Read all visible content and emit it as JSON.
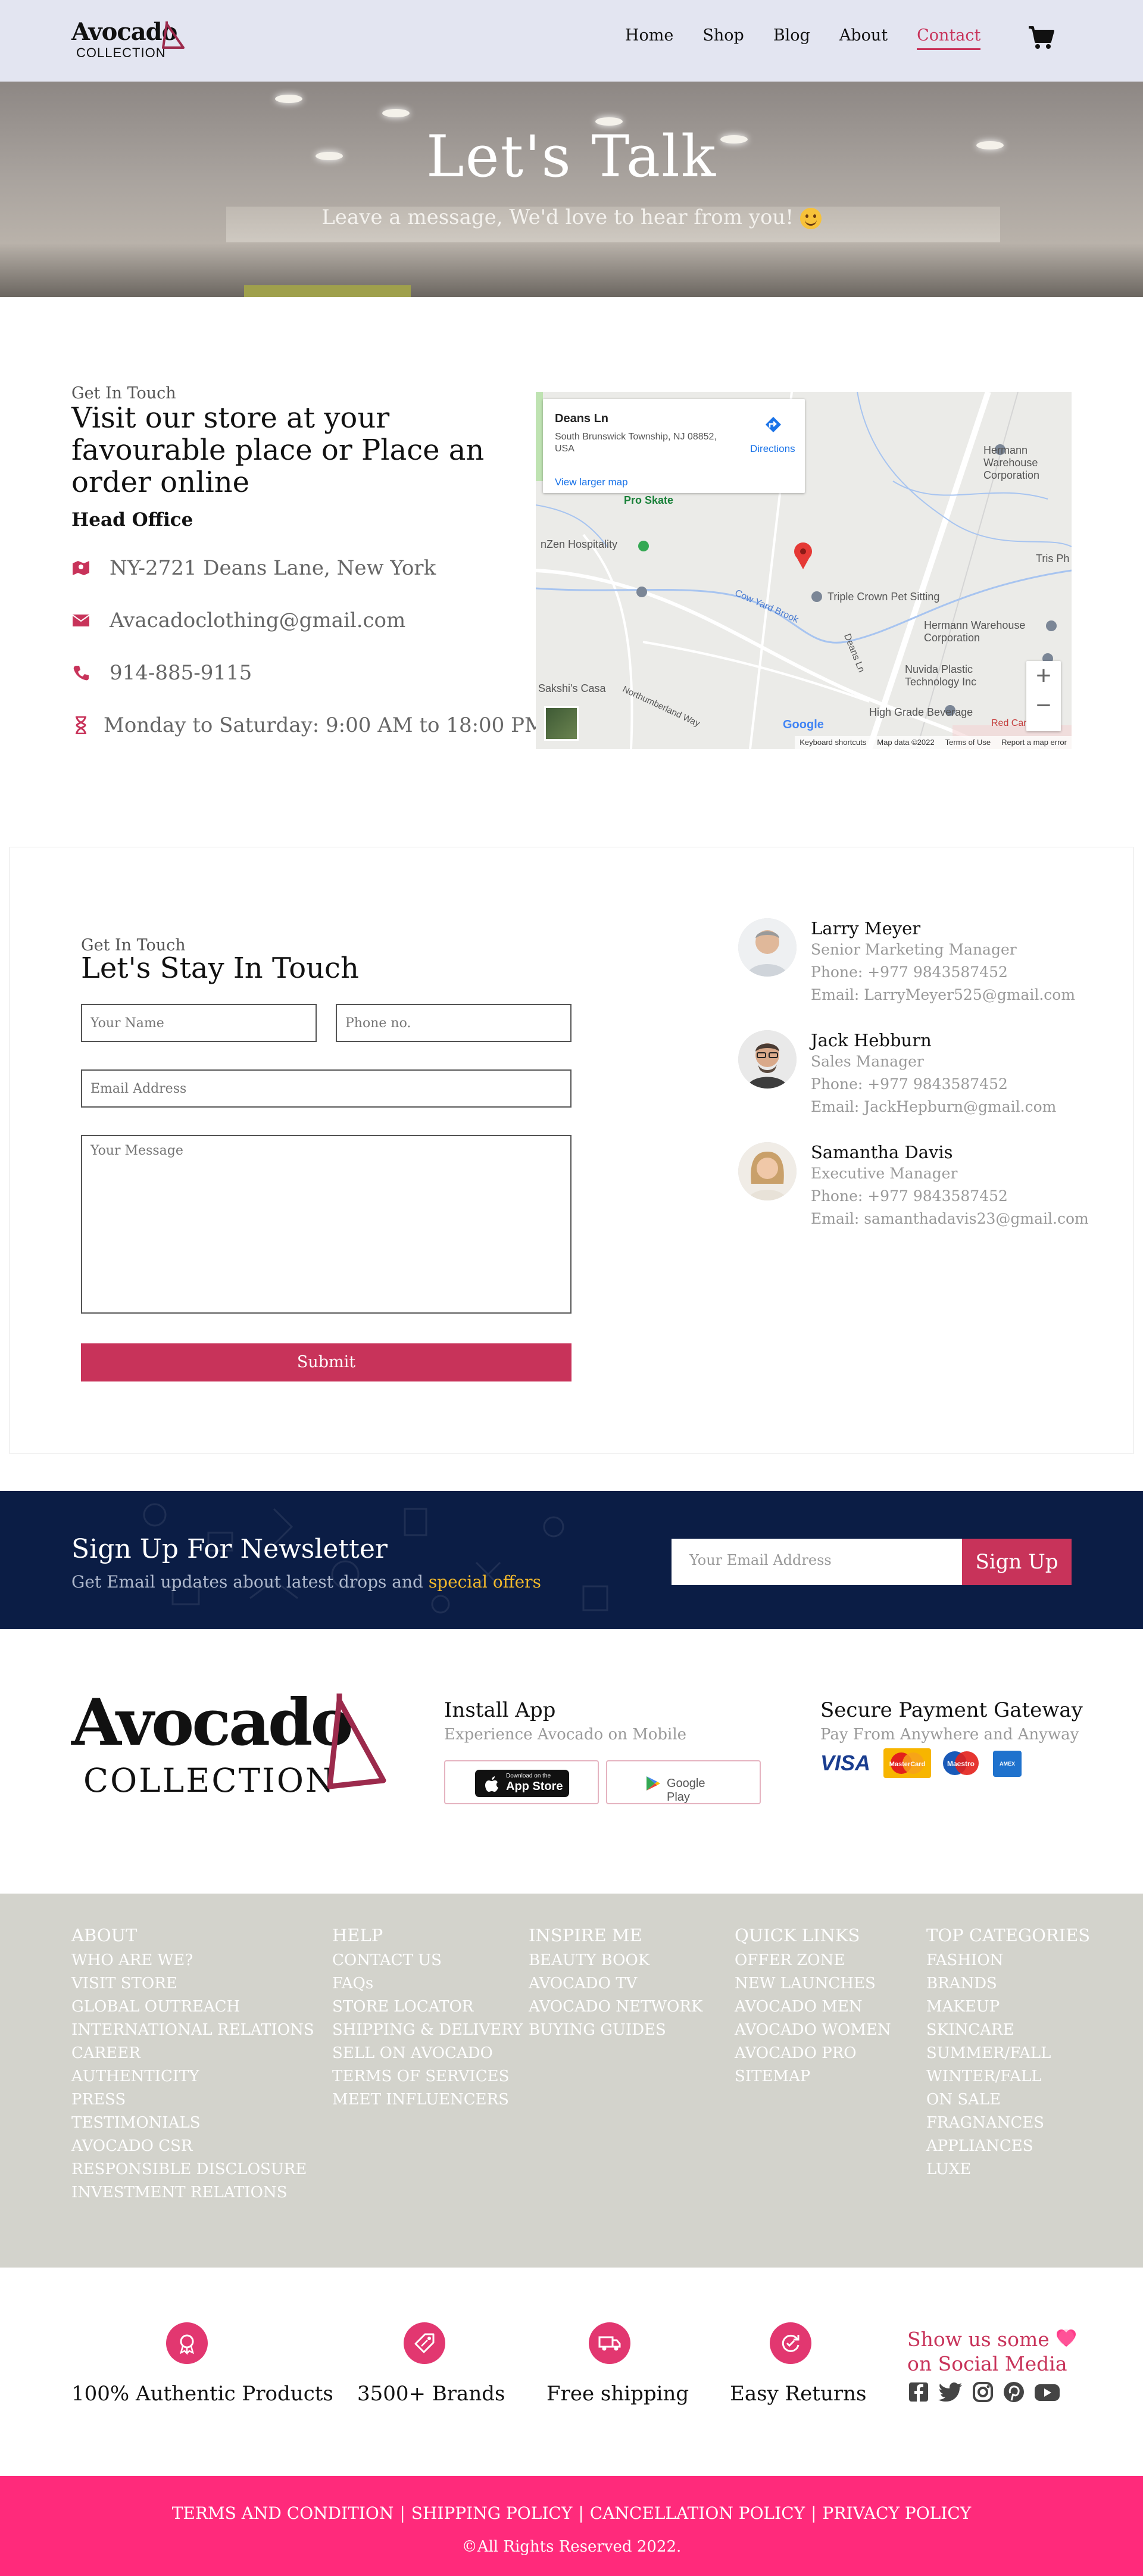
{
  "brand": {
    "name": "Avocado",
    "sub": "COLLECTION",
    "accent": "#c8335a",
    "footer_pink": "#ff2a7b",
    "navy": "#0b1d45"
  },
  "nav": {
    "items": [
      "Home",
      "Shop",
      "Blog",
      "About",
      "Contact"
    ],
    "active": "Contact",
    "cart_icon": "cart-icon"
  },
  "hero": {
    "title": "Let's Talk",
    "subtitle": "Leave a message, We'd love to hear from you!"
  },
  "visit": {
    "small": "Get In Touch",
    "title": "Visit our store at your favourable place or Place an order online",
    "head_office": "Head Office",
    "address": "NY-2721 Deans Lane, New York",
    "email": "Avacadoclothing@gmail.com",
    "phone": "914-885-9115",
    "hours": "Monday to Saturday: 9:00 AM to 18:00 PM"
  },
  "map": {
    "place": "Deans Ln",
    "address": "South Brunswick Township, NJ 08852, USA",
    "directions": "Directions",
    "larger": "View larger map",
    "labels": [
      "Pro Skate",
      "nZen Hospitality",
      "Hermann Warehouse Corporation",
      "Triple Crown Pet Sitting",
      "Hermann Warehouse Corporation",
      "Nuvida Plastic Technology Inc",
      "High Grade Beverage",
      "Cow Yard Brook",
      "Deans Ln",
      "Tris Ph",
      "Red Carpet Inn",
      "Northumberland Way",
      "Sakshi's Casa"
    ],
    "footer": [
      "Keyboard shortcuts",
      "Map data ©2022",
      "Terms of Use",
      "Report a map error"
    ],
    "google": "Google"
  },
  "form": {
    "small": "Get In Touch",
    "title": "Let's Stay In Touch",
    "name_ph": "Your Name",
    "phone_ph": "Phone no.",
    "email_ph": "Email Address",
    "message_ph": "Your Message",
    "submit": "Submit"
  },
  "contacts": [
    {
      "name": "Larry Meyer",
      "role": "Senior Marketing Manager",
      "phone": "Phone: +977 9843587452",
      "email": "Email: LarryMeyer525@gmail.com"
    },
    {
      "name": "Jack Hebburn",
      "role": "Sales Manager",
      "phone": "Phone: +977 9843587452",
      "email": "Email: JackHepburn@gmail.com"
    },
    {
      "name": "Samantha Davis",
      "role": "Executive Manager",
      "phone": "Phone: +977 9843587452",
      "email": "Email: samanthadavis23@gmail.com"
    }
  ],
  "newsletter": {
    "title": "Sign Up For Newsletter",
    "text": "Get Email updates about latest drops and ",
    "highlight": "special offers",
    "placeholder": "Your Email Address",
    "button": "Sign Up"
  },
  "app": {
    "title": "Install App",
    "sub": "Experience Avocado on Mobile",
    "appstore_small": "Download on the",
    "appstore": "App Store",
    "googleplay": "Google Play"
  },
  "payment": {
    "title": "Secure Payment Gateway",
    "sub": "Pay From Anywhere and Anyway",
    "cards": [
      "VISA",
      "MasterCard",
      "Maestro",
      "AMEX"
    ]
  },
  "footer_cols": [
    {
      "title": "ABOUT",
      "items": [
        "WHO ARE WE?",
        "VISIT STORE",
        "GLOBAL OUTREACH",
        "INTERNATIONAL RELATIONS",
        "CAREER",
        "AUTHENTICITY",
        "PRESS",
        "TESTIMONIALS",
        "AVOCADO CSR",
        "RESPONSIBLE DISCLOSURE",
        "INVESTMENT RELATIONS"
      ]
    },
    {
      "title": "HELP",
      "items": [
        "CONTACT US",
        "FAQs",
        "STORE LOCATOR",
        "SHIPPING & DELIVERY",
        "SELL ON AVOCADO",
        "TERMS OF SERVICES",
        "MEET INFLUENCERS"
      ]
    },
    {
      "title": "INSPIRE ME",
      "items": [
        "BEAUTY BOOK",
        "AVOCADO TV",
        "AVOCADO NETWORK",
        "BUYING GUIDES"
      ]
    },
    {
      "title": "QUICK LINKS",
      "items": [
        "OFFER ZONE",
        "NEW LAUNCHES",
        "AVOCADO MEN",
        "AVOCADO WOMEN",
        "AVOCADO PRO",
        "SITEMAP"
      ]
    },
    {
      "title": "TOP CATEGORIES",
      "items": [
        "FASHION",
        "BRANDS",
        "MAKEUP",
        "SKINCARE",
        "SUMMER/FALL",
        "WINTER/FALL",
        "ON SALE",
        "FRAGNANCES",
        "APPLIANCES",
        "LUXE"
      ]
    }
  ],
  "features": [
    "100% Authentic Products",
    "3500+ Brands",
    "Free shipping",
    "Easy Returns"
  ],
  "social": {
    "line1": "Show us some",
    "line2": "on Social Media",
    "icons": [
      "facebook-icon",
      "twitter-icon",
      "instagram-icon",
      "pinterest-icon",
      "youtube-icon"
    ]
  },
  "bottom": {
    "links": [
      "TERMS AND CONDITION",
      "SHIPPING POLICY",
      "CANCELLATION POLICY",
      "PRIVACY POLICY"
    ],
    "separator": "|",
    "copyright": "©All Rights Reserved 2022."
  }
}
